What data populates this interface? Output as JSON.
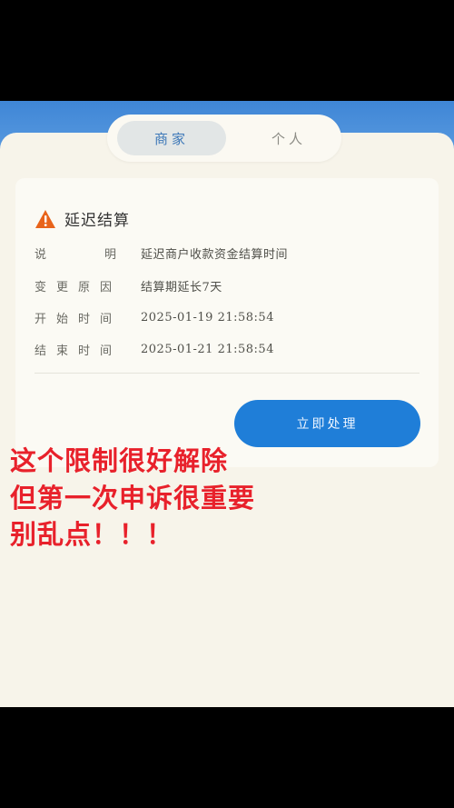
{
  "tabs": {
    "merchant": "商家",
    "personal": "个人",
    "active": "merchant"
  },
  "notice": {
    "icon": "warning-icon",
    "title": "延迟结算",
    "rows": [
      {
        "label": "说明",
        "value": "延迟商户收款资金结算时间"
      },
      {
        "label": "变更原因",
        "value": "结算期延长7天"
      },
      {
        "label": "开始时间",
        "value": "2025-01-19 21:58:54"
      },
      {
        "label": "结束时间",
        "value": "2025-01-21 21:58:54"
      }
    ],
    "action_label": "立即处理"
  },
  "overlay_caption": {
    "line1": "这个限制很好解除",
    "line2": "但第一次申诉很重要",
    "line3": "别乱点！！！"
  },
  "colors": {
    "accent_blue": "#1f7ed8",
    "warning_orange": "#e8631a",
    "caption_red": "#e8212b"
  }
}
